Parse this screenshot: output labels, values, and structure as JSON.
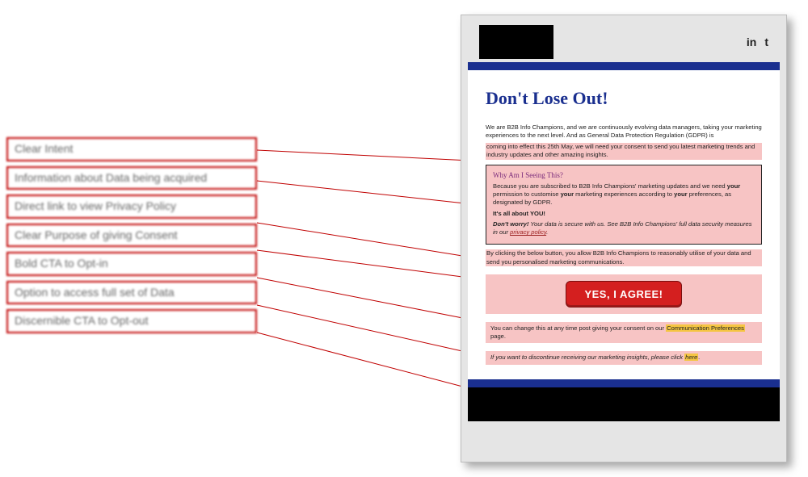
{
  "labels": [
    "Clear Intent",
    "Information about Data being acquired",
    "Direct link to view Privacy Policy",
    "Clear Purpose of giving Consent",
    "Bold CTA to Opt-in",
    "Option to access full set of Data",
    "Discernible CTA to Opt-out"
  ],
  "email": {
    "social": {
      "linkedin": "in",
      "twitter": "t"
    },
    "title": "Don't Lose Out!",
    "intro1": "We are B2B Info Champions, and we are continuously evolving data managers, taking your marketing experiences to the next level. And as General Data Protection Regulation (GDPR) is",
    "intro2": "coming into effect this 25th May, we will need your consent to send you latest marketing trends and industry updates and other amazing insights.",
    "box": {
      "heading": "Why Am I Seeing This?",
      "p1a": "Because you are subscribed to B2B Info Champions' marketing updates and we need ",
      "p1b": "your",
      "p1c": " permission to customise ",
      "p1d": "your",
      "p1e": " marketing experiences according to ",
      "p1f": "your",
      "p1g": " preferences, as designated by GDPR.",
      "p2": "It's all about YOU!",
      "p3a": "Don't worry!",
      "p3b": " Your data is secure with us. See B2B Info Champions' full data security measures in our ",
      "p3c": "privacy policy"
    },
    "confirm": "By clicking the below button, you allow B2B Info Champions to reasonably utilise of your data and send you personalised marketing communications.",
    "cta": "YES, I AGREE!",
    "prefs_pre": "You can change this at any time post giving your consent on our ",
    "prefs_link": "Communication Preferences",
    "prefs_post": " page.",
    "optout_pre": "If you want to discontinue receiving our marketing insights, please click ",
    "optout_link": "here"
  }
}
